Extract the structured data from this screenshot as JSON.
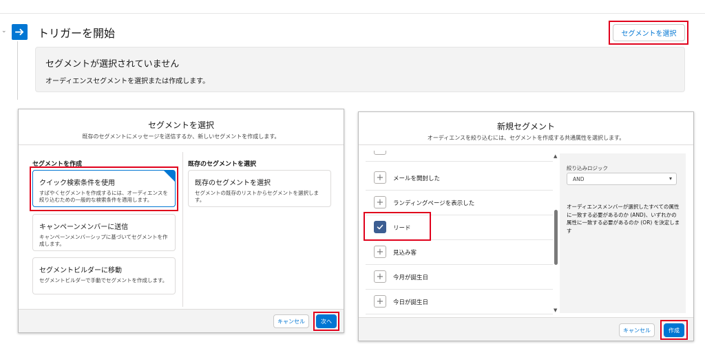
{
  "trigger": {
    "title": "トリガーを開始",
    "select_button": "セグメントを選択",
    "empty_title": "セグメントが選択されていません",
    "empty_desc": "オーディエンスセグメントを選択または作成します。"
  },
  "select_modal": {
    "title": "セグメントを選択",
    "subtitle": "既存のセグメントにメッセージを送信するか、新しいセグメントを作成します。",
    "create_heading": "セグメントを作成",
    "existing_heading": "既存のセグメントを選択",
    "cards": [
      {
        "title": "クイック検索条件を使用",
        "desc": "すばやくセグメントを作成するには、オーディエンスを絞り込むための一般的な検索条件を適用します。"
      },
      {
        "title": "キャンペーンメンバーに送信",
        "desc": "キャンペーンメンバーシップに基づいてセグメントを作成します。"
      },
      {
        "title": "セグメントビルダーに移動",
        "desc": "セグメントビルダーで手動でセグメントを作成します。"
      }
    ],
    "existing_card": {
      "title": "既存のセグメントを選択",
      "desc": "セグメントの既存のリストからセグメントを選択します。"
    },
    "cancel": "キャンセル",
    "next": "次へ"
  },
  "new_modal": {
    "title": "新規セグメント",
    "subtitle": "オーディエンスを絞り込むには、セグメントを作成する共通属性を選択します。",
    "rows": [
      {
        "label": "メールを開封した",
        "checked": false
      },
      {
        "label": "ランディングページを表示した",
        "checked": false
      },
      {
        "label": "リード",
        "checked": true
      },
      {
        "label": "見込み客",
        "checked": false
      },
      {
        "label": "今月が誕生日",
        "checked": false
      },
      {
        "label": "今日が誕生日",
        "checked": false
      }
    ],
    "logic_label": "絞り込みロジック",
    "logic_value": "AND",
    "logic_desc": "オーディエンスメンバーが選択したすべての属性に一致する必要があるのか (AND)、いずれかの属性に一致する必要があるのか (OR) を決定します",
    "cancel": "キャンセル",
    "create": "作成"
  },
  "icons": {
    "trigger": "arrow-right-icon",
    "add": "plus-icon",
    "check": "check-icon",
    "caret": "chevron-down-icon"
  },
  "colors": {
    "brand": "#0176d3",
    "highlight": "#e0001b",
    "checked_box": "#3c5e92"
  }
}
